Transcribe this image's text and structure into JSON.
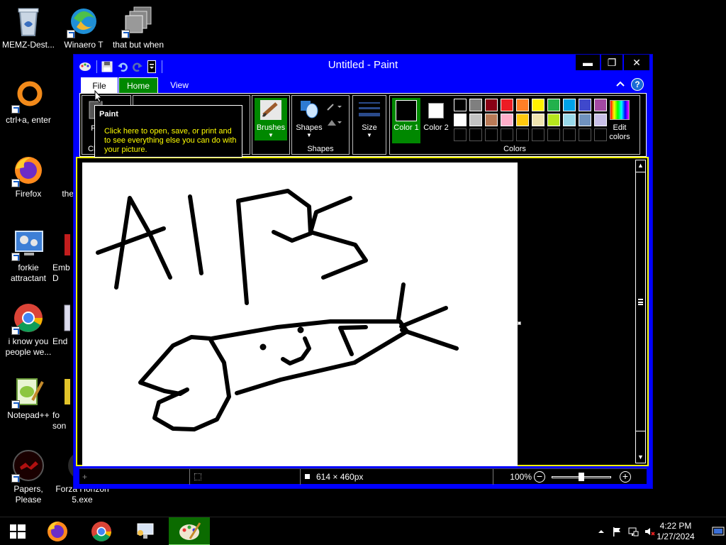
{
  "desktop": {
    "icons": [
      {
        "label": "MEMZ-Dest..."
      },
      {
        "label": "Winaero T"
      },
      {
        "label": "that but when"
      },
      {
        "label": "ctrl+a, enter"
      },
      {
        "label": "Firefox"
      },
      {
        "label": "the"
      },
      {
        "label": "forkie attractant"
      },
      {
        "label": "Emb D"
      },
      {
        "label": "i know you people we..."
      },
      {
        "label": "End"
      },
      {
        "label": "Notepad++"
      },
      {
        "label": "fo son"
      },
      {
        "label": "Papers, Please"
      },
      {
        "label": "Forza Horizon 5.exe"
      }
    ]
  },
  "window": {
    "title": "Untitled - Paint",
    "controls": {
      "minimize": "▬",
      "maximize": "❐",
      "close": "✕"
    },
    "menu": {
      "file": "File",
      "home": "Home",
      "view": "View"
    },
    "ribbon": {
      "clipboard_partial": "Pa",
      "clipboard_group_partial": "Cl",
      "brushes": "Brushes",
      "shapes": "Shapes",
      "shapes_group": "Shapes",
      "size": "Size",
      "color1": "Color 1",
      "color2": "Color 2",
      "edit_colors": "Edit colors",
      "colors_group": "Colors"
    },
    "palette": {
      "row1": [
        "#000000",
        "#7f7f7f",
        "#880015",
        "#ed1c24",
        "#ff7f27",
        "#fff200",
        "#22b14c",
        "#00a2e8",
        "#3f48cc",
        "#a349a4"
      ],
      "row2": [
        "#ffffff",
        "#c3c3c3",
        "#b97a57",
        "#ffaec9",
        "#ffc90e",
        "#efe4b0",
        "#b5e61d",
        "#99d9ea",
        "#7092be",
        "#c8bfe7"
      ]
    },
    "color1_value": "#000000",
    "color2_value": "#ffffff",
    "tooltip": {
      "title": "Paint",
      "body": "Click here to open, save, or print and to see everything else you can do with your picture."
    },
    "status": {
      "dimensions": "614 × 460px",
      "zoom": "100%"
    }
  },
  "taskbar": {
    "time": "4:22 PM",
    "date": "1/27/2024",
    "apps": [
      "windows-start",
      "firefox",
      "chrome",
      "network-app",
      "paint"
    ]
  },
  "colors": {
    "titlebar": "#0000ff",
    "accent_green": "#008800",
    "highlight_yellow": "#ffff00"
  }
}
